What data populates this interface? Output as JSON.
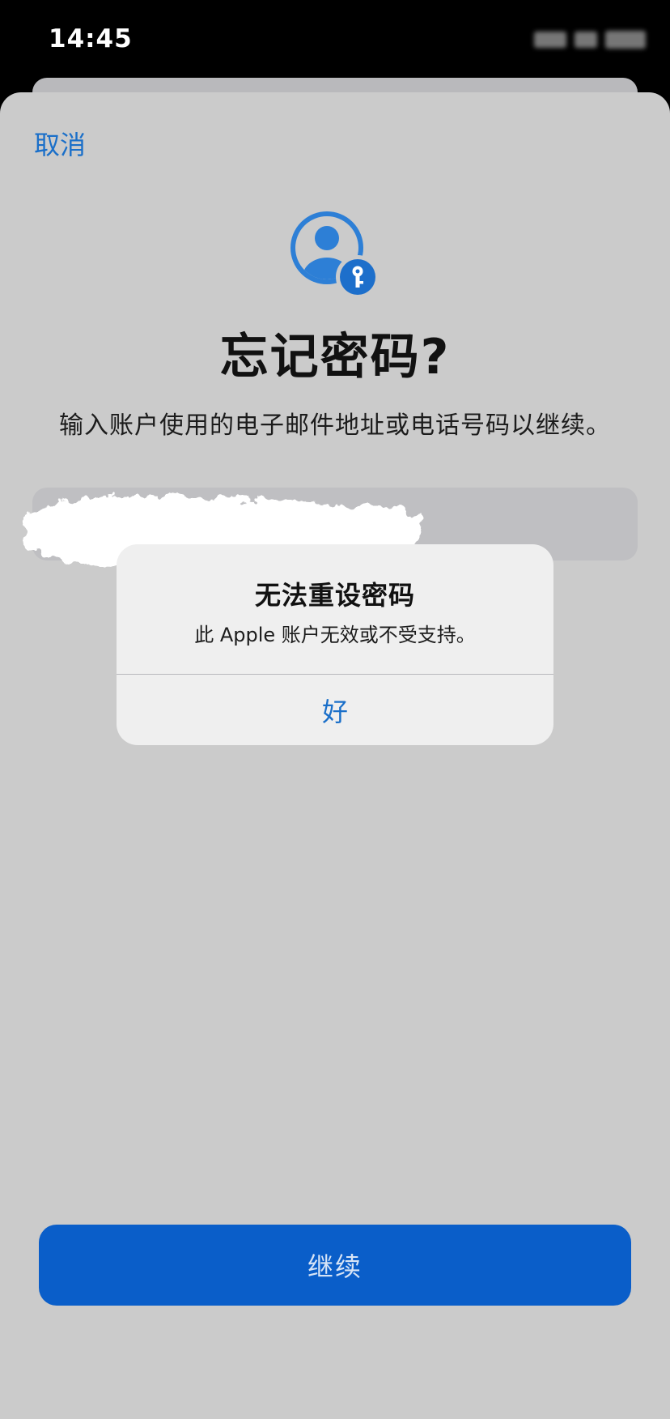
{
  "status_bar": {
    "time": "14:45"
  },
  "sheet": {
    "cancel_label": "取消",
    "hero_icon": "person-key-icon",
    "title": "忘记密码?",
    "subtitle": "输入账户使用的电子邮件地址或电话号码以继续。",
    "input": {
      "value": "",
      "placeholder": ""
    },
    "continue_label": "继续"
  },
  "alert": {
    "title": "无法重设密码",
    "message": "此 Apple 账户无效或不受支持。",
    "ok_label": "好"
  },
  "colors": {
    "accent": "#1a6fc9",
    "primary_button": "#0a5ec9",
    "sheet_background": "#cbcbcb",
    "alert_background": "#efefef"
  }
}
